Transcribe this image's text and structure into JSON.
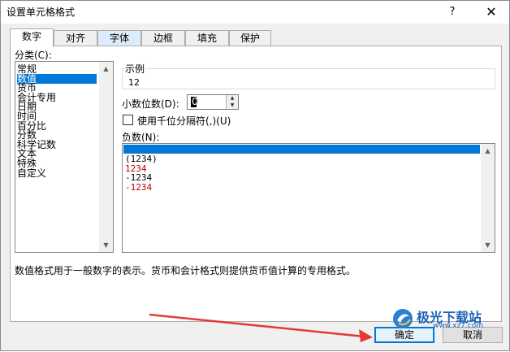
{
  "window": {
    "title": "设置单元格格式",
    "help_glyph": "?",
    "close_glyph": "✕"
  },
  "tabs": [
    {
      "label": "数字"
    },
    {
      "label": "对齐"
    },
    {
      "label": "字体"
    },
    {
      "label": "边框"
    },
    {
      "label": "填充"
    },
    {
      "label": "保护"
    }
  ],
  "category": {
    "label": "分类(C):",
    "items": [
      "常规",
      "数值",
      "货币",
      "会计专用",
      "日期",
      "时间",
      "百分比",
      "分数",
      "科学记数",
      "文本",
      "特殊",
      "自定义"
    ],
    "selected": "数值"
  },
  "sample": {
    "label": "示例",
    "value": "12"
  },
  "decimal": {
    "label": "小数位数(D):",
    "value": "0"
  },
  "thousands": {
    "label": "使用千位分隔符(,)(U)",
    "checked": false
  },
  "negative": {
    "label": "负数(N):",
    "items": [
      "(1234)",
      "(1234)",
      "1234",
      "-1234",
      "-1234"
    ],
    "red_flags": [
      true,
      false,
      true,
      false,
      true
    ]
  },
  "description": "数值格式用于一般数字的表示。货币和会计格式则提供货币值计算的专用格式。",
  "buttons": {
    "ok": "确定",
    "cancel": "取消"
  },
  "watermark": {
    "brand": "极光下载站",
    "url": "www.xz7.com"
  },
  "colors": {
    "selection": "#0078d7",
    "negative_red": "#c00000",
    "arrow": "#e53935",
    "tab_highlight": "#dcecfc"
  }
}
